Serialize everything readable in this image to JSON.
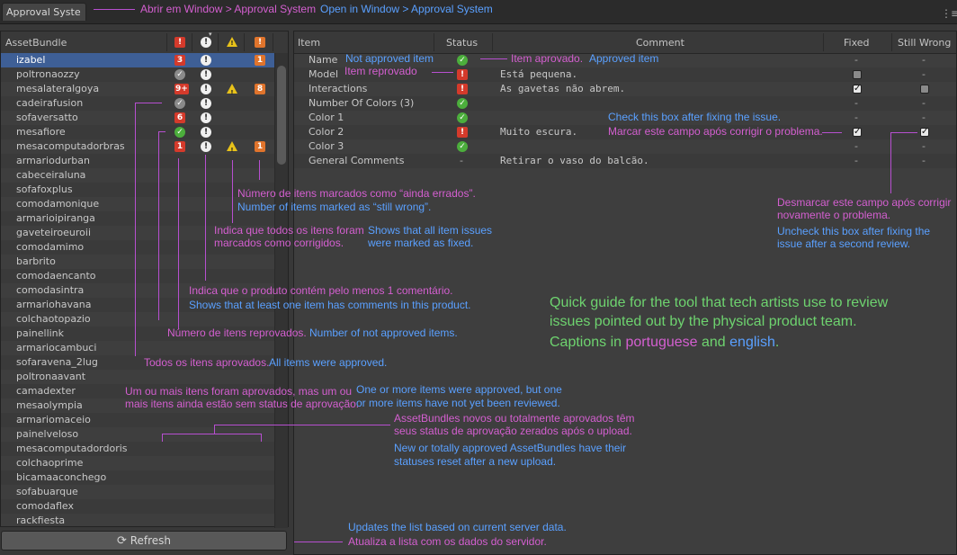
{
  "window": {
    "tab_label": "Approval Syste",
    "menu_icon": "menu-dots-icon"
  },
  "left": {
    "header": {
      "label": "AssetBundle",
      "col1": "!",
      "col2": "!",
      "col3": "!",
      "col4": "!"
    },
    "items": [
      {
        "name": "izabel",
        "red": "3",
        "comment": true,
        "orange": "1",
        "selected": true
      },
      {
        "name": "poltronaozzy",
        "approved": "gray",
        "comment": true
      },
      {
        "name": "mesalateralgoya",
        "red": "9+",
        "comment": true,
        "warn": true,
        "orange": "8"
      },
      {
        "name": "cadeirafusion",
        "approved": "gray",
        "comment": true
      },
      {
        "name": "sofaversatto",
        "red": "6",
        "comment": true
      },
      {
        "name": "mesafiore",
        "approved": "green",
        "comment": true
      },
      {
        "name": "mesacomputadorbras",
        "red": "1",
        "comment": true,
        "warn": true,
        "orange": "1"
      },
      {
        "name": "armariodurban"
      },
      {
        "name": "cabeceiraluna"
      },
      {
        "name": "sofafoxplus"
      },
      {
        "name": "comodamonique"
      },
      {
        "name": "armarioipiranga"
      },
      {
        "name": "gaveteiroeuroii"
      },
      {
        "name": "comodamimo"
      },
      {
        "name": "barbrito"
      },
      {
        "name": "comodaencanto"
      },
      {
        "name": "comodasintra"
      },
      {
        "name": "armariohavana"
      },
      {
        "name": "colchaotopazio"
      },
      {
        "name": "painellink"
      },
      {
        "name": "armariocambuci"
      },
      {
        "name": "sofaravena_2lug"
      },
      {
        "name": "poltronaavant"
      },
      {
        "name": "camadexter"
      },
      {
        "name": "mesaolympia"
      },
      {
        "name": "armariomaceio"
      },
      {
        "name": "painelveloso"
      },
      {
        "name": "mesacomputadordoris"
      },
      {
        "name": "colchaoprime"
      },
      {
        "name": "bicamaaconchego"
      },
      {
        "name": "sofabuarque"
      },
      {
        "name": "comodaflex"
      },
      {
        "name": "rackfiesta"
      }
    ],
    "refresh_label": "Refresh"
  },
  "right": {
    "header": {
      "item": "Item",
      "status": "Status",
      "comment": "Comment",
      "fixed": "Fixed",
      "still_wrong": "Still Wrong"
    },
    "rows": [
      {
        "item": "Name",
        "status": "ok",
        "comment": "",
        "fixed": "-",
        "still": "-"
      },
      {
        "item": "Model",
        "status": "bad",
        "comment": "Está pequena.",
        "fixed": "off",
        "still": "-"
      },
      {
        "item": "Interactions",
        "status": "bad",
        "comment": "As gavetas não abrem.",
        "fixed": "on",
        "still": "off"
      },
      {
        "item": "Number Of Colors (3)",
        "status": "ok",
        "comment": "",
        "fixed": "-",
        "still": "-"
      },
      {
        "item": "Color 1",
        "status": "ok",
        "comment": "",
        "fixed": "-",
        "still": "-"
      },
      {
        "item": "Color 2",
        "status": "bad",
        "comment": "Muito escura.",
        "fixed": "on",
        "still": "on"
      },
      {
        "item": "Color 3",
        "status": "ok",
        "comment": "",
        "fixed": "-",
        "still": "-"
      },
      {
        "item": "General Comments",
        "status": "-",
        "comment": "Retirar o vaso do balcão.",
        "fixed": "-",
        "still": "-"
      }
    ]
  },
  "annotations": {
    "open_pt": "Abrir em Window > Approval System",
    "open_en": "Open in Window > Approval System",
    "not_approved_item": "Not approved item",
    "item_reprovado": "Item reprovado",
    "item_aprovado": "Item aprovado.",
    "approved_item": "Approved item",
    "check_en": "Check this box after fixing the issue.",
    "check_pt": "Marcar este campo após corrigir o problema.",
    "still_pt_1": "Número de itens marcados como “ainda errados”.",
    "still_en_1": "Number of items marked as “still wrong”.",
    "fixed_pt_1": "Indica que todos os itens foram",
    "fixed_pt_2": "marcados como corrigidos.",
    "fixed_en_1": "Shows that all item issues",
    "fixed_en_2": "were marked as fixed.",
    "uncheck_pt_1": "Desmarcar este campo após corrigir",
    "uncheck_pt_2": "novamente o problema.",
    "uncheck_en_1": "Uncheck this box after fixing the",
    "uncheck_en_2": "issue after a second review.",
    "comment_pt": "Indica que o produto contém pelo menos 1 comentário.",
    "comment_en": "Shows that at least one item has comments in this product.",
    "guide_1": "Quick guide for the tool that tech artists use to review",
    "guide_2": "issues pointed out by the physical product team.",
    "guide_3a": "Captions in ",
    "guide_3b": "portuguese",
    "guide_3c": " and ",
    "guide_3d": "english",
    "guide_3e": ".",
    "notapproved_pt": "Número de itens reprovados.",
    "notapproved_en": "Number of not approved items.",
    "allapproved_pt": "Todos os itens aprovados.",
    "allapproved_en": "All items were approved.",
    "partial_pt_1": "Um ou mais itens foram aprovados, mas um ou",
    "partial_pt_2": "mais itens ainda estão sem status de aprovação.",
    "partial_en_1": "One or more items were approved, but one",
    "partial_en_2": "or more items have not yet been reviewed.",
    "reset_pt_1": "AssetBundles novos ou totalmente aprovados têm",
    "reset_pt_2": "seus status de aprovação zerados após o upload.",
    "reset_en_1": "New or totally approved AssetBundles have their",
    "reset_en_2": "statuses reset after a new upload.",
    "refresh_en": "Updates the list based on current server data.",
    "refresh_pt": "Atualiza a lista com os dados do servidor."
  }
}
